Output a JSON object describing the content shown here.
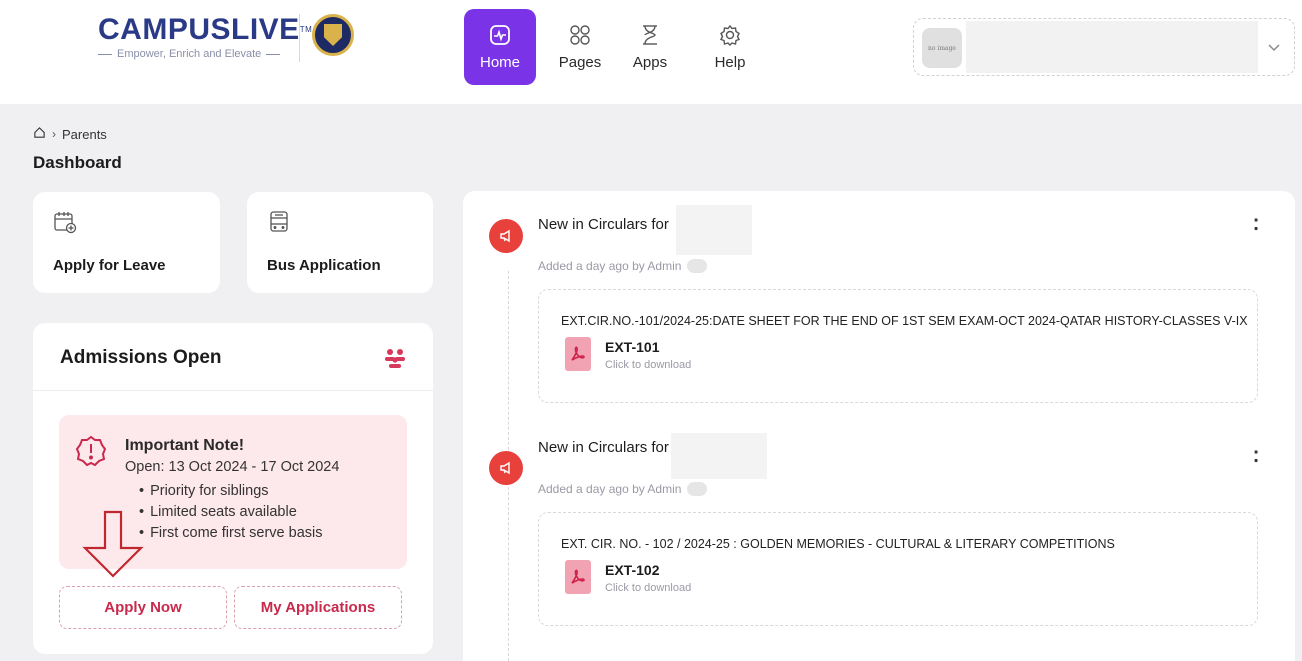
{
  "header": {
    "logo_text": "CAMPUSLIVE",
    "logo_tm": "TM",
    "logo_tagline": "Empower, Enrich and Elevate",
    "nav": [
      {
        "label": "Home",
        "icon": "home-icon",
        "active": true
      },
      {
        "label": "Pages",
        "icon": "grid-icon",
        "active": false
      },
      {
        "label": "Apps",
        "icon": "hourglass-icon",
        "active": false
      },
      {
        "label": "Help",
        "icon": "gear-icon",
        "active": false
      }
    ],
    "profile_avatar_text": "no image"
  },
  "breadcrumb": {
    "current": "Parents"
  },
  "page_title": "Dashboard",
  "quick_actions": [
    {
      "label": "Apply for Leave",
      "icon": "calendar-add-icon"
    },
    {
      "label": "Bus Application",
      "icon": "bus-icon"
    }
  ],
  "admissions": {
    "title": "Admissions Open",
    "note_title": "Important Note!",
    "note_dates": "Open: 13 Oct 2024 - 17 Oct 2024",
    "note_points": [
      "Priority for siblings",
      "Limited seats available",
      "First come first serve basis"
    ],
    "apply_label": "Apply Now",
    "my_apps_label": "My Applications"
  },
  "feed": [
    {
      "title": "New in Circulars for",
      "meta": "Added a day ago by Admin",
      "text": "EXT.CIR.NO.-101/2024-25:DATE SHEET FOR THE END OF 1ST SEM EXAM-OCT 2024-QATAR HISTORY-CLASSES V-IX",
      "file_name": "EXT-101",
      "file_sub": "Click to download"
    },
    {
      "title": "New in Circulars for",
      "meta": "Added a day ago by Admin",
      "text": "EXT. CIR. NO. - 102 / 2024-25 : GOLDEN MEMORIES - CULTURAL & LITERARY COMPETITIONS",
      "file_name": "EXT-102",
      "file_sub": "Click to download"
    }
  ],
  "colors": {
    "accent": "#7a33e6",
    "brand_blue": "#2a3a86",
    "danger": "#e8413c",
    "pink_text": "#c8294c",
    "note_bg": "#fde8ec"
  }
}
